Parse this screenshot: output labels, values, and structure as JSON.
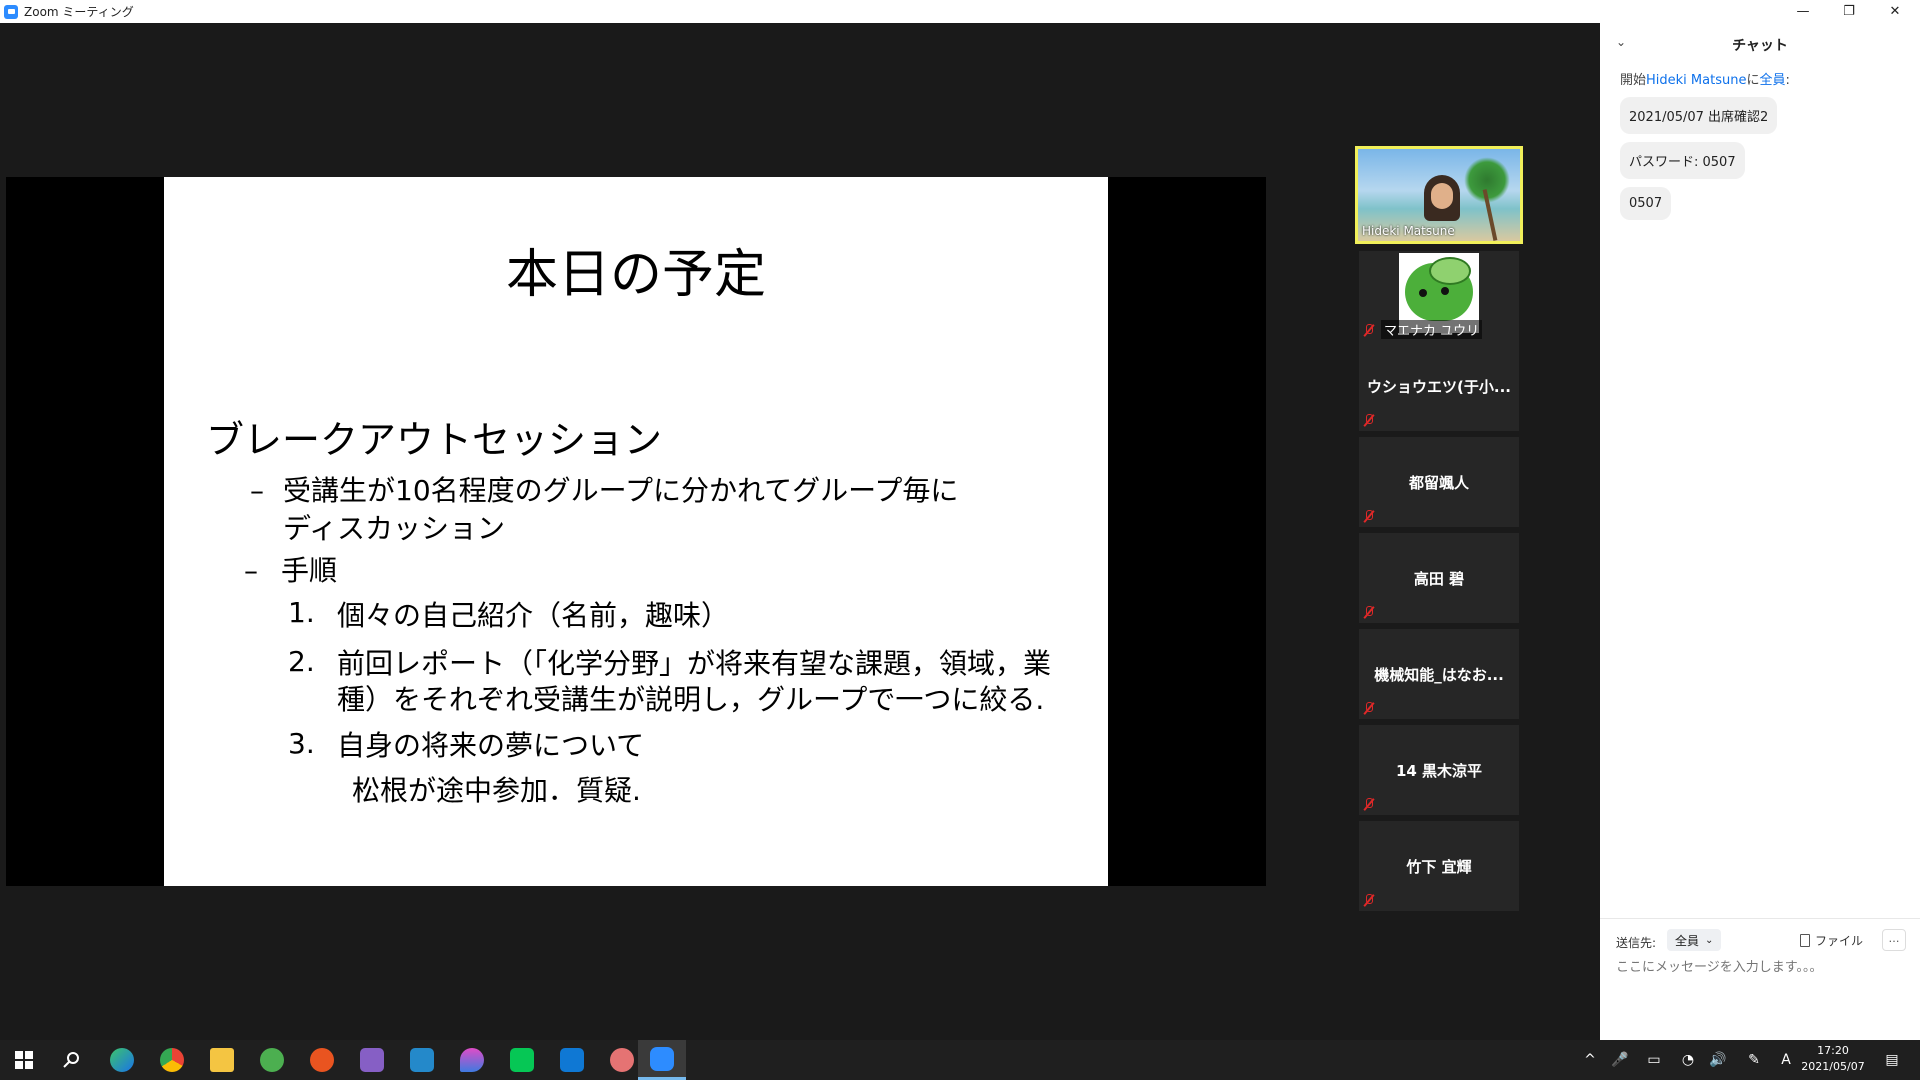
{
  "window": {
    "title": "Zoom ミーティング",
    "minimize": "—",
    "restore": "❐",
    "close": "✕"
  },
  "slide": {
    "title": "本日の予定",
    "section": "ブレークアウトセッション",
    "bullets": [
      {
        "dash": "–",
        "lines": [
          "受講生が10名程度のグループに分かれてグループ毎に",
          "ディスカッション"
        ]
      },
      {
        "dash": "–",
        "lines": [
          "手順"
        ]
      }
    ],
    "steps": [
      {
        "num": "1.",
        "lines": [
          "個々の自己紹介（名前，趣味）"
        ]
      },
      {
        "num": "2.",
        "lines": [
          "前回レポート（「化学分野」が将来有望な課題，領域，業",
          "種）をそれぞれ受講生が説明し，グループで一つに絞る."
        ]
      },
      {
        "num": "3.",
        "lines": [
          "自身の将来の夢について"
        ]
      }
    ],
    "note": "松根が途中参加．質疑."
  },
  "participants": [
    {
      "name": "Hideki Matsune",
      "video": true,
      "muted": false,
      "active_speaker": true
    },
    {
      "name": "マエナカ ユウリ",
      "video": false,
      "avatar": true,
      "muted": true
    },
    {
      "name": "ウショウエツ(于小...",
      "muted": true
    },
    {
      "name": "都留颯人",
      "muted": true
    },
    {
      "name": "高田 碧",
      "muted": true
    },
    {
      "name": "機械知能_はなお...",
      "muted": true
    },
    {
      "name": "14 黒木涼平",
      "muted": true
    },
    {
      "name": "竹下 宜輝",
      "muted": true
    }
  ],
  "chat": {
    "title": "チャット",
    "collapse_icon": "⌄",
    "from_prefix": "開始",
    "from_name": "Hideki Matsune",
    "from_mid": "に",
    "from_target": "全員",
    "from_suffix": ":",
    "messages": [
      "2021/05/07 出席確認2",
      "パスワード: 0507",
      "0507"
    ],
    "to_label": "送信先:",
    "to_value": "全員",
    "file_label": "ファイル",
    "more_label": "…",
    "input_placeholder": "ここにメッセージを入力します。。。"
  },
  "taskbar": {
    "apps": [
      "windows-start",
      "search",
      "edge",
      "chrome",
      "file-explorer",
      "app-green",
      "ubuntu",
      "visual-studio",
      "vscode",
      "app-drop",
      "line",
      "mail",
      "app-brain",
      "zoom"
    ],
    "tray": [
      "^",
      "🎤",
      "▭",
      "◔",
      "🔊",
      "✎",
      "A"
    ],
    "time": "17:20",
    "date": "2021/05/07",
    "notification": "▤"
  },
  "colors": {
    "stage": "#1a1a1a",
    "tile": "#262626",
    "active_speaker_border": "#f1f05a",
    "chat_link": "#0e71eb",
    "mute_red": "#e02828",
    "zoom_blue": "#2d8cff"
  }
}
